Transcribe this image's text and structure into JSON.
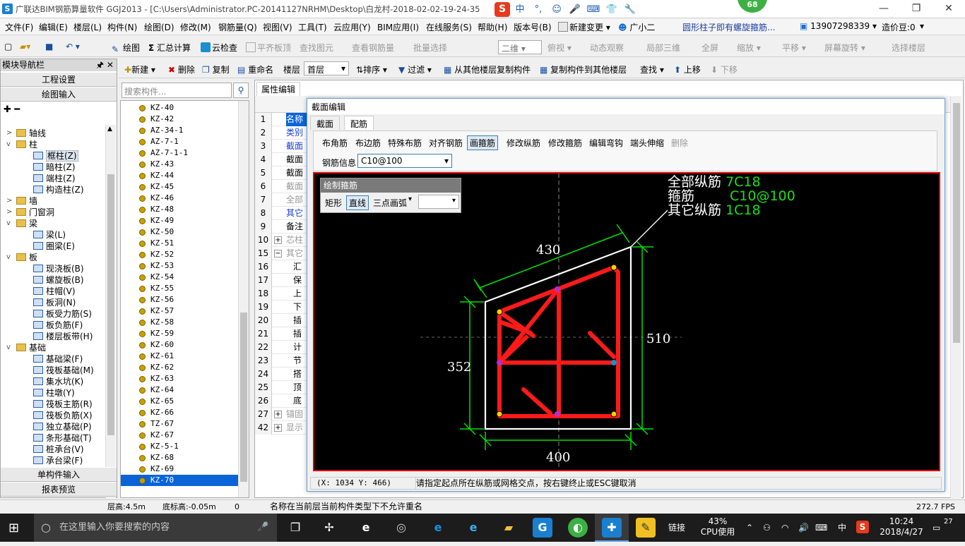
{
  "titlebar": {
    "app_icon": "S",
    "title": "广联达BIM钢筋算量软件 GGJ2013 - [C:\\Users\\Administrator.PC-20141127NRHM\\Desktop\\白龙村-2018-02-02-19-24-35",
    "ime": {
      "logo": "S",
      "items": [
        "中",
        "°,",
        "☺",
        "🎤",
        "⌨",
        "👕",
        "🔧"
      ]
    },
    "badge": "68",
    "controls": [
      "—",
      "❐",
      "✕"
    ]
  },
  "menubar": {
    "items": [
      "文件(F)",
      "编辑(E)",
      "楼层(L)",
      "构件(N)",
      "绘图(D)",
      "修改(M)",
      "钢筋量(Q)",
      "视图(V)",
      "工具(T)",
      "云应用(Y)",
      "BIM应用(I)",
      "在线服务(S)",
      "帮助(H)",
      "版本号(B)"
    ],
    "new_change": "新建变更",
    "assistant": "广小二",
    "notice": "圆形柱子即有螺旋箍筋...",
    "phone": "13907298339",
    "price": "造价豆:0"
  },
  "toolbar1": {
    "draw": "绘图",
    "sum": "汇总计算",
    "cloud": "云检查",
    "flat": "平齐板顶",
    "find": "查找图元",
    "view_rebar": "查看钢筋量",
    "batch": "批量选择",
    "view_mode": "二维",
    "top_view": "俯视",
    "dynamic": "动态观察",
    "local3d": "局部三维",
    "fullscreen": "全屏",
    "zoom": "缩放",
    "pan": "平移",
    "rotate": "屏幕旋转",
    "select_floor": "选择楼层"
  },
  "toolbar2": {
    "new": "新建",
    "delete": "删除",
    "copy": "复制",
    "rename": "重命名",
    "floor_label": "楼层",
    "floor_value": "首层",
    "sort": "排序",
    "filter": "过滤",
    "copy_from": "从其他楼层复制构件",
    "copy_to": "复制构件到其他楼层",
    "find": "查找",
    "up": "上移",
    "down": "下移"
  },
  "nav": {
    "title": "模块导航栏",
    "pin": "🖈 ✕",
    "engineering": "工程设置",
    "draw_input": "绘图输入",
    "tree": [
      {
        "level": 0,
        "expand": ">",
        "label": "轴线",
        "icon": "folder"
      },
      {
        "level": 0,
        "expand": "v",
        "label": "柱",
        "icon": "folder"
      },
      {
        "level": 1,
        "expand": "",
        "label": "框柱(Z)",
        "icon": "col",
        "sel": true
      },
      {
        "level": 1,
        "expand": "",
        "label": "暗柱(Z)",
        "icon": "col"
      },
      {
        "level": 1,
        "expand": "",
        "label": "端柱(Z)",
        "icon": "col"
      },
      {
        "level": 1,
        "expand": "",
        "label": "构造柱(Z)",
        "icon": "col"
      },
      {
        "level": 0,
        "expand": ">",
        "label": "墙",
        "icon": "folder"
      },
      {
        "level": 0,
        "expand": ">",
        "label": "门窗洞",
        "icon": "folder"
      },
      {
        "level": 0,
        "expand": "v",
        "label": "梁",
        "icon": "folder"
      },
      {
        "level": 1,
        "expand": "",
        "label": "梁(L)",
        "icon": "beam"
      },
      {
        "level": 1,
        "expand": "",
        "label": "圈梁(E)",
        "icon": "beam"
      },
      {
        "level": 0,
        "expand": "v",
        "label": "板",
        "icon": "folder"
      },
      {
        "level": 1,
        "expand": "",
        "label": "现浇板(B)",
        "icon": "slab"
      },
      {
        "level": 1,
        "expand": "",
        "label": "螺旋板(B)",
        "icon": "slab"
      },
      {
        "level": 1,
        "expand": "",
        "label": "柱帽(V)",
        "icon": "slab"
      },
      {
        "level": 1,
        "expand": "",
        "label": "板洞(N)",
        "icon": "slab"
      },
      {
        "level": 1,
        "expand": "",
        "label": "板受力筋(S)",
        "icon": "slab"
      },
      {
        "level": 1,
        "expand": "",
        "label": "板负筋(F)",
        "icon": "slab"
      },
      {
        "level": 1,
        "expand": "",
        "label": "楼层板带(H)",
        "icon": "slab"
      },
      {
        "level": 0,
        "expand": "v",
        "label": "基础",
        "icon": "folder"
      },
      {
        "level": 1,
        "expand": "",
        "label": "基础梁(F)",
        "icon": "found"
      },
      {
        "level": 1,
        "expand": "",
        "label": "筏板基础(M)",
        "icon": "found"
      },
      {
        "level": 1,
        "expand": "",
        "label": "集水坑(K)",
        "icon": "found"
      },
      {
        "level": 1,
        "expand": "",
        "label": "柱墩(Y)",
        "icon": "found"
      },
      {
        "level": 1,
        "expand": "",
        "label": "筏板主筋(R)",
        "icon": "found"
      },
      {
        "level": 1,
        "expand": "",
        "label": "筏板负筋(X)",
        "icon": "found"
      },
      {
        "level": 1,
        "expand": "",
        "label": "独立基础(P)",
        "icon": "found"
      },
      {
        "level": 1,
        "expand": "",
        "label": "条形基础(T)",
        "icon": "found"
      },
      {
        "level": 1,
        "expand": "",
        "label": "桩承台(V)",
        "icon": "found"
      },
      {
        "level": 1,
        "expand": "",
        "label": "承台梁(F)",
        "icon": "found"
      }
    ],
    "single_input": "单构件输入",
    "report": "报表预览"
  },
  "list": {
    "search_placeholder": "搜索构件...",
    "items": [
      "KZ-40",
      "KZ-42",
      "AZ-34-1",
      "AZ-7-1",
      "AZ-7-1-1",
      "KZ-43",
      "KZ-44",
      "KZ-45",
      "KZ-46",
      "KZ-48",
      "KZ-49",
      "KZ-50",
      "KZ-51",
      "KZ-52",
      "KZ-53",
      "KZ-54",
      "KZ-55",
      "KZ-56",
      "KZ-57",
      "KZ-58",
      "KZ-59",
      "KZ-60",
      "KZ-61",
      "KZ-62",
      "KZ-63",
      "KZ-64",
      "KZ-65",
      "KZ-66",
      "TZ-67",
      "KZ-67",
      "KZ-5-1",
      "KZ-68",
      "KZ-69",
      "KZ-70"
    ],
    "selected": "KZ-70"
  },
  "props": {
    "tab": "属性编辑",
    "rows": [
      {
        "n": "1",
        "v": "名称",
        "style": "sel"
      },
      {
        "n": "2",
        "v": "类别",
        "style": "blue"
      },
      {
        "n": "3",
        "v": "截面",
        "style": "blue"
      },
      {
        "n": "4",
        "v": "截面",
        "style": ""
      },
      {
        "n": "5",
        "v": "截面",
        "style": ""
      },
      {
        "n": "6",
        "v": "截面",
        "style": "gray"
      },
      {
        "n": "7",
        "v": "全部",
        "style": "gray"
      },
      {
        "n": "8",
        "v": "其它",
        "style": "blue"
      },
      {
        "n": "9",
        "v": "备注",
        "style": ""
      },
      {
        "n": "10",
        "v": "芯柱",
        "style": "gray",
        "exp": "+"
      },
      {
        "n": "15",
        "v": "其它",
        "style": "gray",
        "exp": "−"
      },
      {
        "n": "16",
        "v": "汇",
        "style": "",
        "indent": true
      },
      {
        "n": "17",
        "v": "保",
        "style": "",
        "indent": true
      },
      {
        "n": "18",
        "v": "上",
        "style": "",
        "indent": true
      },
      {
        "n": "19",
        "v": "下",
        "style": "",
        "indent": true
      },
      {
        "n": "20",
        "v": "插",
        "style": "",
        "indent": true
      },
      {
        "n": "21",
        "v": "插",
        "style": "",
        "indent": true
      },
      {
        "n": "22",
        "v": "计",
        "style": "",
        "indent": true
      },
      {
        "n": "23",
        "v": "节",
        "style": "",
        "indent": true
      },
      {
        "n": "24",
        "v": "搭",
        "style": "",
        "indent": true
      },
      {
        "n": "25",
        "v": "顶",
        "style": "",
        "indent": true
      },
      {
        "n": "26",
        "v": "底",
        "style": "",
        "indent": true
      },
      {
        "n": "27",
        "v": "锚固",
        "style": "gray",
        "exp": "+"
      },
      {
        "n": "42",
        "v": "显示",
        "style": "gray",
        "exp": "+"
      }
    ]
  },
  "dialog": {
    "title": "截面编辑",
    "tabs": [
      "截面",
      "配筋"
    ],
    "active_tab": "配筋",
    "buttons": [
      "布角筋",
      "布边筋",
      "特殊布筋",
      "对齐钢筋",
      "画箍筋",
      "修改纵筋",
      "修改箍筋",
      "编辑弯钩",
      "端头伸缩",
      "删除"
    ],
    "active_button": "画箍筋",
    "rebar_label": "钢筋信息",
    "rebar_value": "C10@100",
    "draw_panel": {
      "title": "绘制箍筋",
      "rect": "矩形",
      "line": "直线",
      "arc": "三点画弧"
    },
    "annot": {
      "all_label": "全部纵筋",
      "all_value": "7C18",
      "stirrup_label": "箍筋",
      "stirrup_value": "C10@100",
      "other_label": "其它纵筋",
      "other_value": "1C18"
    },
    "dims": {
      "top": "430",
      "right": "510",
      "left": "352",
      "bottom": "400"
    },
    "coords": "(X: 1034 Y: 466)",
    "hint": "请指定起点所在纵筋或网格交点，按右键终止或ESC键取消"
  },
  "status": {
    "floor_height": "层高:4.5m",
    "bottom_elev": "底标高:-0.05m",
    "zero": "0",
    "message": "名称在当前层当前构件类型下不允许重名",
    "fps": "272.7 FPS"
  },
  "taskbar": {
    "search": "在这里输入你要搜索的内容",
    "link": "链接",
    "cpu_pct": "43%",
    "cpu_label": "CPU使用",
    "lang": "中",
    "time": "10:24",
    "date": "2018/4/27",
    "notif": "27"
  },
  "colors": {
    "accent": "#0a64d8",
    "canvas_bg": "#000000",
    "rebar": "#ff1a1a",
    "dim": "#00e000",
    "border_red": "#e00000"
  }
}
